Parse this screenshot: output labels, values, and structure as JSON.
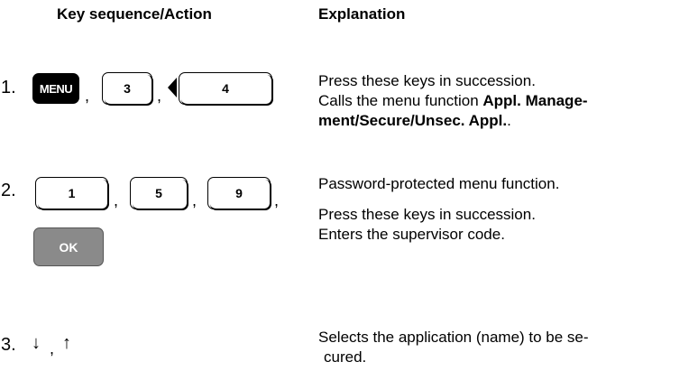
{
  "headers": {
    "left": "Key sequence/Action",
    "right": "Explanation"
  },
  "steps": [
    {
      "number": "1.",
      "keys": [
        "MENU",
        "3",
        "4"
      ],
      "separator": ",",
      "explanation_line1": "Press these keys in succession.",
      "explanation_line2_prefix": "Calls the menu function ",
      "explanation_line2_bold": "Appl. Manage-",
      "explanation_line3_bold": "ment/Secure/Unsec. Appl.",
      "explanation_line3_suffix": "."
    },
    {
      "number": "2.",
      "keys": [
        "1",
        "5",
        "9",
        "OK"
      ],
      "separator": ",",
      "explanation_line1": "Password-protected menu function.",
      "explanation_line2": "Press these keys in succession.",
      "explanation_line3": "Enters the supervisor code."
    },
    {
      "number": "3.",
      "keys": [
        "↓",
        "↑"
      ],
      "separator": ",",
      "explanation_line1": "Selects the application (name) to be se-",
      "explanation_line2": "cured."
    }
  ]
}
